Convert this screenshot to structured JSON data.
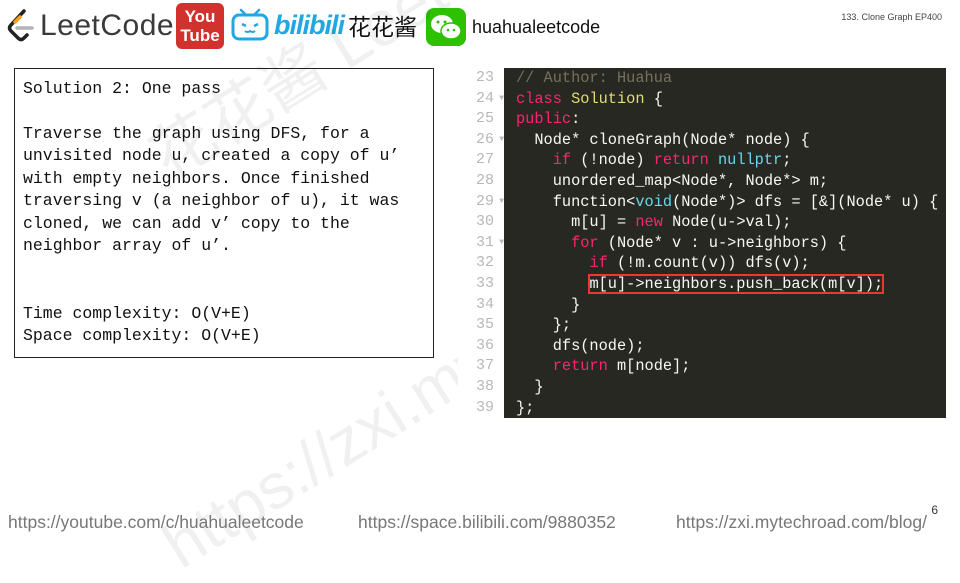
{
  "header": {
    "leetcode_text": "LeetCode",
    "youtube_top": "You",
    "youtube_bottom": "Tube",
    "bilibili_word": "bilibili",
    "bilibili_name": "花花酱",
    "wechat_name": "huahualeetcode",
    "episode_title": "133. Clone Graph EP400"
  },
  "solution": {
    "title": "Solution 2: One pass",
    "lines": [
      "Traverse the graph using DFS, for a",
      "unvisited node u, created a copy of u’",
      "with empty neighbors. Once finished",
      "traversing v (a neighbor of u), it was",
      "cloned, we can add v’ copy to the",
      "neighbor array of u’."
    ],
    "time_complexity": "Time complexity: O(V+E)",
    "space_complexity": "Space complexity: O(V+E)"
  },
  "code": {
    "line_numbers": [
      "23",
      "24",
      "25",
      "26",
      "27",
      "28",
      "29",
      "30",
      "31",
      "32",
      "33",
      "34",
      "35",
      "36",
      "37",
      "38",
      "39"
    ],
    "folds": [
      "24",
      "26",
      "29",
      "31"
    ],
    "lines": [
      "// Author: Huahua",
      "class Solution {",
      "public:",
      "  Node* cloneGraph(Node* node) {",
      "    if (!node) return nullptr;",
      "    unordered_map<Node*, Node*> m;",
      "    function<void(Node*)> dfs = [&](Node* u) {",
      "      m[u] = new Node(u->val);",
      "      for (Node* v : u->neighbors) {",
      "        if (!m.count(v)) dfs(v);",
      "        m[u]->neighbors.push_back(m[v]);",
      "      }",
      "    };",
      "    dfs(node);",
      "    return m[node];",
      "  }",
      "};"
    ]
  },
  "watermark": {
    "text1": "花花酱 LeetCode",
    "text2": "https://zxi.mytechroad.com"
  },
  "footer": {
    "youtube_url": "https://youtube.com/c/huahualeetcode",
    "bilibili_url": "https://space.bilibili.com/9880352",
    "blog_url": "https://zxi.mytechroad.com/blog/",
    "page_number": "6"
  },
  "colors": {
    "code_bg": "#272822",
    "highlight_box": "#e83a2e",
    "keyword": "#f92672",
    "type": "#66d9ef",
    "class_name": "#e6db74",
    "comment": "#75715e"
  }
}
